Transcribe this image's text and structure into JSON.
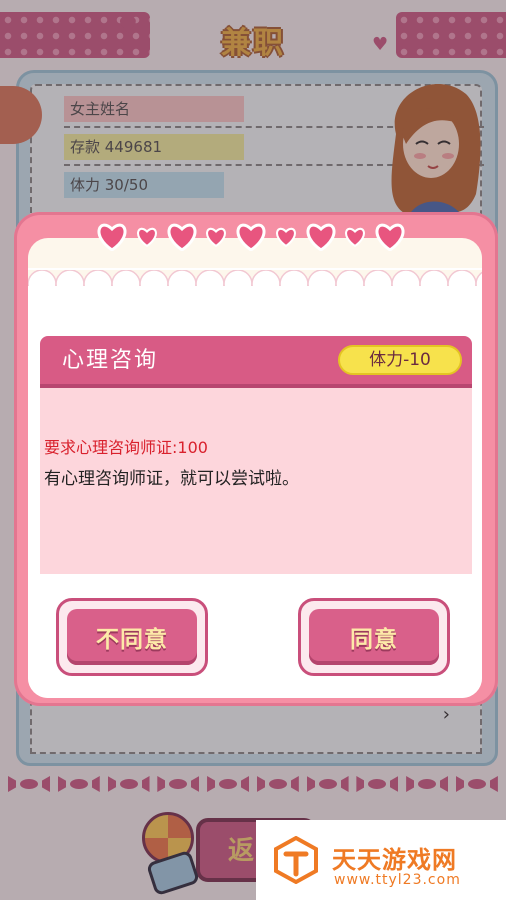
{
  "screen": {
    "title": "兼职"
  },
  "status": {
    "name_label": "女主姓名",
    "money_label": "存款 449681",
    "stamina_label": "体力 30/50"
  },
  "dialog": {
    "title": "心理咨询",
    "cost": "体力-10",
    "requirement": "要求心理咨询师证:100",
    "description": "有心理咨询师证，就可以尝试啦。",
    "disagree_label": "不同意",
    "agree_label": "同意"
  },
  "background": {
    "back_button_label": "返"
  },
  "watermark": {
    "brand": "天天游戏网",
    "url": "www.ttyl23.com"
  },
  "colors": {
    "modal_pink": "#f58fa4",
    "title_bar": "#d85b85",
    "cost_pill": "#f7e24c",
    "requirement_red": "#d9212d",
    "button_pink": "#d9608a",
    "watermark_orange": "#ef7a24"
  }
}
